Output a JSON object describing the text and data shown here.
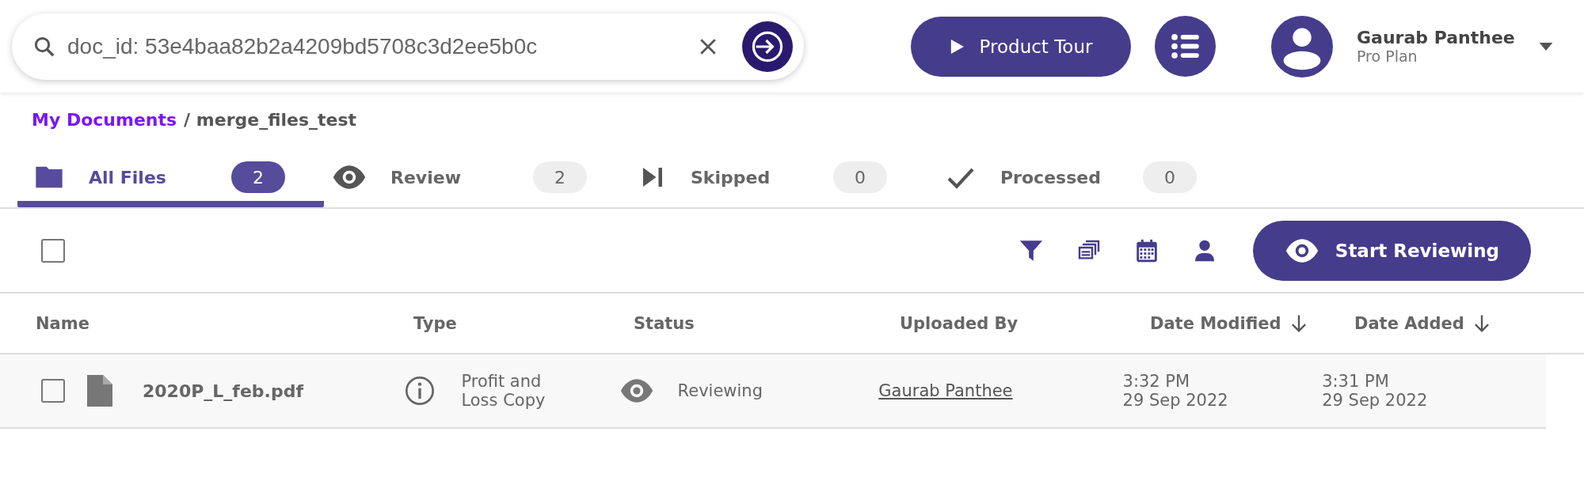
{
  "search": {
    "value": "doc_id: 53e4baa82b2a4209bd5708c3d2ee5b0c"
  },
  "header": {
    "product_tour": "Product Tour",
    "user": {
      "name": "Gaurab Panthee",
      "plan": "Pro Plan"
    }
  },
  "breadcrumb": [
    "My Documents",
    "/ merge_files_test"
  ],
  "tabs": [
    {
      "label": "All Files",
      "count": "2",
      "kind": "folder",
      "selected": true
    },
    {
      "label": "Review",
      "count": "2",
      "kind": "eye",
      "selected": false
    },
    {
      "label": "Skipped",
      "count": "0",
      "kind": "skip",
      "selected": false
    },
    {
      "label": "Processed",
      "count": "0",
      "kind": "check",
      "selected": false
    }
  ],
  "toolbar": {
    "select_all_checked": false,
    "start_reviewing": "Start Reviewing"
  },
  "table": {
    "columns": [
      {
        "label": "Name",
        "sorted": false
      },
      {
        "label": "Type",
        "sorted": false
      },
      {
        "label": "Status",
        "sorted": false
      },
      {
        "label": "Uploaded By",
        "sorted": false
      },
      {
        "label": "Date Modified",
        "sorted": true
      },
      {
        "label": "Date Added",
        "sorted": true
      }
    ],
    "rows": [
      {
        "checked": false,
        "name": "2020P_L_feb.pdf",
        "type": "Profit and Loss Copy",
        "status": "Reviewing",
        "uploaded_by": "Gaurab Panthee",
        "date_modified": [
          "3:32 PM",
          "29 Sep 2022"
        ],
        "date_added": [
          "3:31 PM",
          "29 Sep 2022"
        ]
      }
    ]
  }
}
